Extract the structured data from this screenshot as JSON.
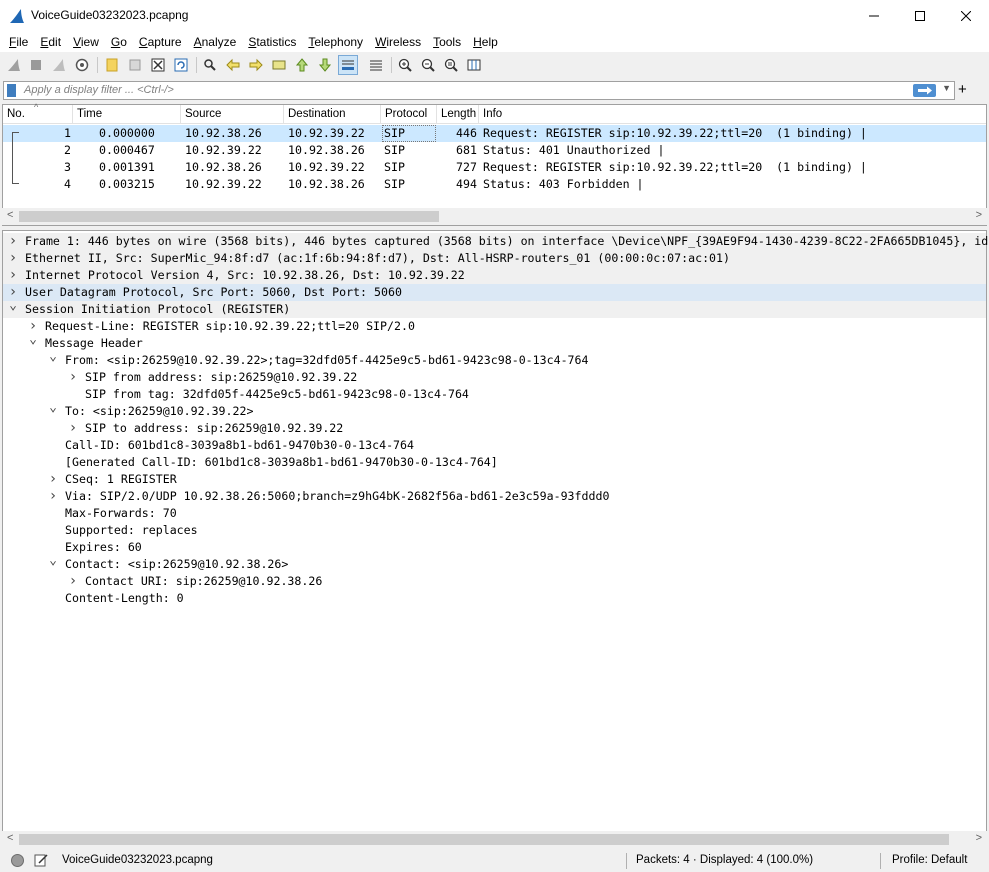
{
  "window": {
    "title": "VoiceGuide03232023.pcapng"
  },
  "menu": [
    {
      "label": "File"
    },
    {
      "label": "Edit"
    },
    {
      "label": "View"
    },
    {
      "label": "Go"
    },
    {
      "label": "Capture"
    },
    {
      "label": "Analyze"
    },
    {
      "label": "Statistics"
    },
    {
      "label": "Telephony"
    },
    {
      "label": "Wireless"
    },
    {
      "label": "Tools"
    },
    {
      "label": "Help"
    }
  ],
  "filter": {
    "placeholder": "Apply a display filter ... <Ctrl-/>",
    "apply_glyph": "⟹"
  },
  "packet_list": {
    "columns": [
      "No.",
      "Time",
      "Source",
      "Destination",
      "Protocol",
      "Length",
      "Info"
    ],
    "rows": [
      {
        "no": "1",
        "time": "0.000000",
        "source": "10.92.38.26",
        "destination": "10.92.39.22",
        "protocol": "SIP",
        "length": "446",
        "info": "Request: REGISTER sip:10.92.39.22;ttl=20  (1 binding) |"
      },
      {
        "no": "2",
        "time": "0.000467",
        "source": "10.92.39.22",
        "destination": "10.92.38.26",
        "protocol": "SIP",
        "length": "681",
        "info": "Status: 401 Unauthorized |"
      },
      {
        "no": "3",
        "time": "0.001391",
        "source": "10.92.38.26",
        "destination": "10.92.39.22",
        "protocol": "SIP",
        "length": "727",
        "info": "Request: REGISTER sip:10.92.39.22;ttl=20  (1 binding) |"
      },
      {
        "no": "4",
        "time": "0.003215",
        "source": "10.92.39.22",
        "destination": "10.92.38.26",
        "protocol": "SIP",
        "length": "494",
        "info": "Status: 403 Forbidden |"
      }
    ]
  },
  "details": [
    {
      "text": "Frame 1: 446 bytes on wire (3568 bits), 446 bytes captured (3568 bits) on interface \\Device\\NPF_{39AE9F94-1430-4239-8C22-2FA665DB1045}, id",
      "chev": "closed"
    },
    {
      "text": "Ethernet II, Src: SuperMic_94:8f:d7 (ac:1f:6b:94:8f:d7), Dst: All-HSRP-routers_01 (00:00:0c:07:ac:01)",
      "chev": "closed"
    },
    {
      "text": "Internet Protocol Version 4, Src: 10.92.38.26, Dst: 10.92.39.22",
      "chev": "closed"
    },
    {
      "text": "User Datagram Protocol, Src Port: 5060, Dst Port: 5060",
      "chev": "closed"
    },
    {
      "text": "Session Initiation Protocol (REGISTER)",
      "chev": "open"
    },
    {
      "text": "Request-Line: REGISTER sip:10.92.39.22;ttl=20 SIP/2.0",
      "chev": "closed"
    },
    {
      "text": "Message Header",
      "chev": "open"
    },
    {
      "text": "From: <sip:26259@10.92.39.22>;tag=32dfd05f-4425e9c5-bd61-9423c98-0-13c4-764",
      "chev": "open"
    },
    {
      "text": "SIP from address: sip:26259@10.92.39.22",
      "chev": "closed"
    },
    {
      "text": "SIP from tag: 32dfd05f-4425e9c5-bd61-9423c98-0-13c4-764",
      "chev": "none"
    },
    {
      "text": "To: <sip:26259@10.92.39.22>",
      "chev": "open"
    },
    {
      "text": "SIP to address: sip:26259@10.92.39.22",
      "chev": "closed"
    },
    {
      "text": "Call-ID: 601bd1c8-3039a8b1-bd61-9470b30-0-13c4-764",
      "chev": "none"
    },
    {
      "text": "[Generated Call-ID: 601bd1c8-3039a8b1-bd61-9470b30-0-13c4-764]",
      "chev": "none"
    },
    {
      "text": "CSeq: 1 REGISTER",
      "chev": "closed"
    },
    {
      "text": "Via: SIP/2.0/UDP 10.92.38.26:5060;branch=z9hG4bK-2682f56a-bd61-2e3c59a-93fddd0",
      "chev": "closed"
    },
    {
      "text": "Max-Forwards: 70",
      "chev": "none"
    },
    {
      "text": "Supported: replaces",
      "chev": "none"
    },
    {
      "text": "Expires: 60",
      "chev": "none"
    },
    {
      "text": "Contact: <sip:26259@10.92.38.26>",
      "chev": "open"
    },
    {
      "text": "Contact URI: sip:26259@10.92.38.26",
      "chev": "closed"
    },
    {
      "text": "Content-Length: 0",
      "chev": "none"
    }
  ],
  "status": {
    "file": "VoiceGuide03232023.pcapng",
    "packets": "Packets: 4 · Displayed: 4 (100.0%)",
    "profile": "Profile: Default"
  },
  "colors": {
    "selected_row": "#cce8ff",
    "highlight_row": "#dbe8f5",
    "shaded_row": "#f0f0f0"
  },
  "icons": [
    "shark-fin-icon",
    "minimize-icon",
    "maximize-icon",
    "close-icon"
  ]
}
